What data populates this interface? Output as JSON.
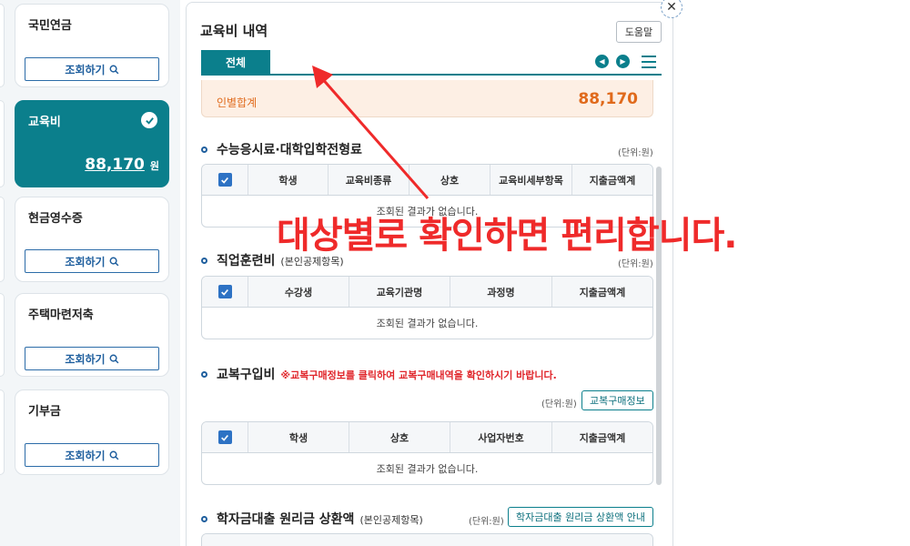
{
  "left_cards": [
    {
      "title": "국민연금",
      "button": "조회하기"
    },
    {
      "title": "교육비",
      "amount": "88,170",
      "unit": "원",
      "selected": true
    },
    {
      "title": "현금영수증",
      "button": "조회하기"
    },
    {
      "title": "주택마련저축",
      "button": "조회하기"
    },
    {
      "title": "기부금",
      "button": "조회하기"
    }
  ],
  "panel": {
    "title": "교육비 내역",
    "help_label": "도움말",
    "tab_all": "전체",
    "summary": {
      "label": "인별합계",
      "value": "88,170"
    }
  },
  "sections": {
    "suneung": {
      "title": "수능응시료·대학입학전형료",
      "unit": "(단위:원)",
      "headers": [
        "학생",
        "교육비종류",
        "상호",
        "교육비세부항목",
        "지출금액계"
      ],
      "empty": "조회된 결과가 없습니다."
    },
    "vocational": {
      "title": "직업훈련비",
      "sub": "(본인공제항목)",
      "unit": "(단위:원)",
      "headers": [
        "수강생",
        "교육기관명",
        "과정명",
        "지출금액계"
      ],
      "empty": "조회된 결과가 없습니다."
    },
    "uniform": {
      "title": "교복구입비",
      "note": "※교복구매정보를 클릭하여 교복구매내역을 확인하시기 바랍니다.",
      "unit": "(단위:원)",
      "button": "교복구매정보",
      "headers": [
        "학생",
        "상호",
        "사업자번호",
        "지출금액계"
      ],
      "empty": "조회된 결과가 없습니다."
    },
    "loan": {
      "title": "학자금대출 원리금 상환액",
      "sub": "(본인공제항목)",
      "unit": "(단위:원)",
      "button": "학자금대출 원리금 상환액 안내"
    }
  },
  "overlay": {
    "text": "대상별로 확인하면 편리합니다."
  },
  "colors": {
    "teal": "#0b7f8c",
    "orange": "#e06a1c",
    "red_annotation": "#ef2a2a",
    "blue_checkbox": "#2d72c4"
  }
}
